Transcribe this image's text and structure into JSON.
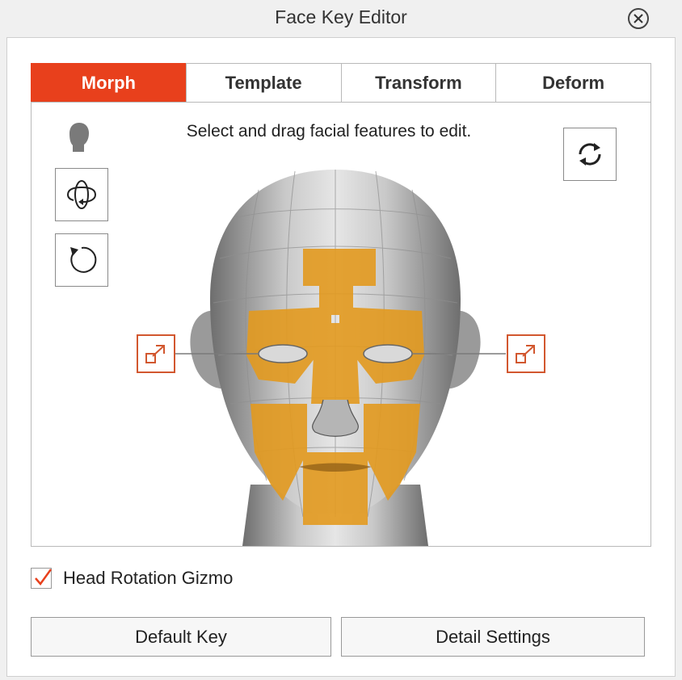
{
  "window": {
    "title": "Face Key Editor",
    "close_icon": "close-icon"
  },
  "tabs": [
    {
      "label": "Morph",
      "active": true
    },
    {
      "label": "Template",
      "active": false
    },
    {
      "label": "Transform",
      "active": false
    },
    {
      "label": "Deform",
      "active": false
    }
  ],
  "viewport": {
    "instruction": "Select and drag facial features to edit.",
    "head_icon": "head-silhouette-icon",
    "tools": [
      "rotate-view-icon",
      "reset-rotation-icon"
    ],
    "mirror_icon": "sync-icon",
    "feature_handle_icon": "expand-icon"
  },
  "options": {
    "head_rotation_gizmo_label": "Head Rotation Gizmo",
    "head_rotation_gizmo_checked": true
  },
  "buttons": {
    "default_key": "Default Key",
    "detail_settings": "Detail Settings"
  },
  "colors": {
    "accent": "#e8401c",
    "highlight": "#e39a1f",
    "handle": "#d2572f"
  }
}
